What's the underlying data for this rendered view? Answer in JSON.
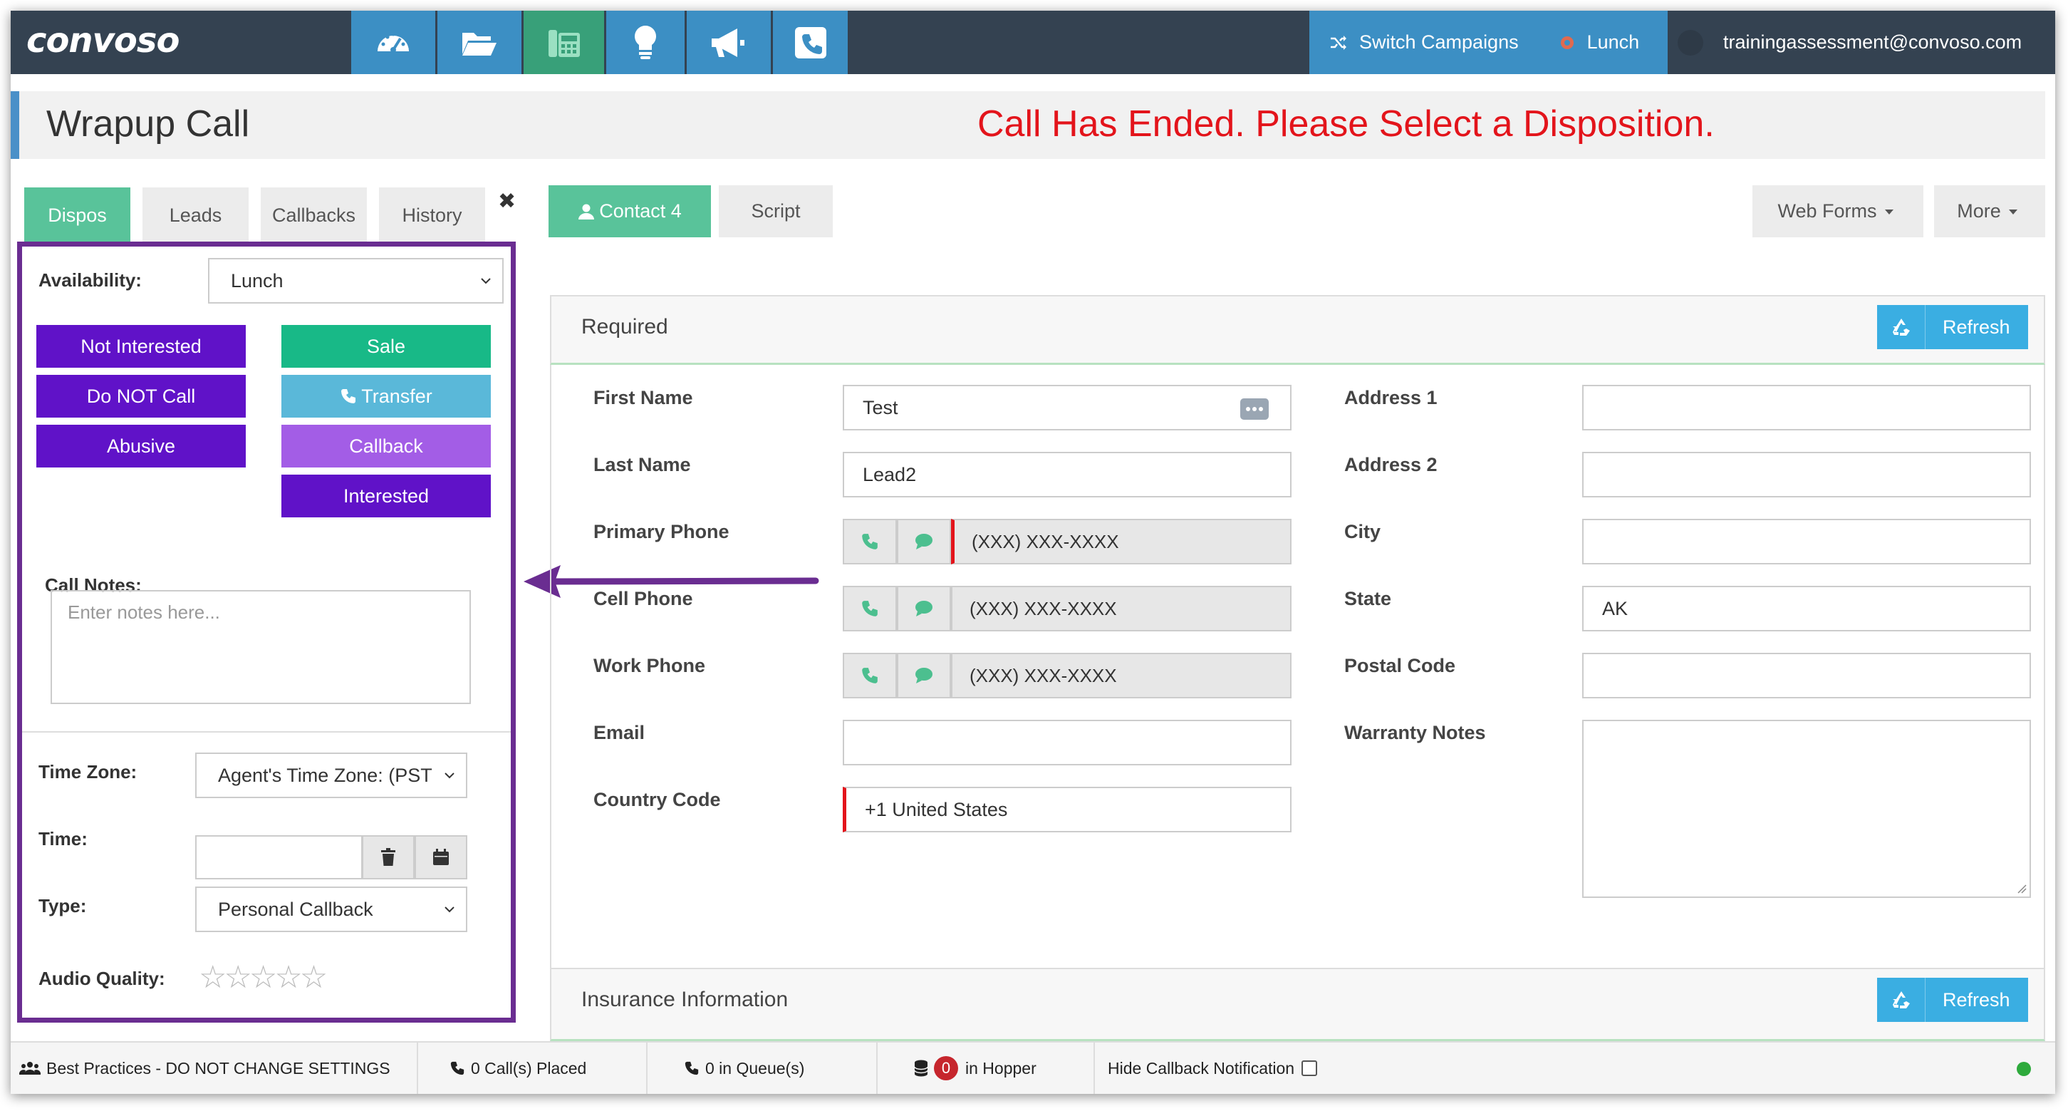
{
  "app": {
    "logo": "convoso"
  },
  "topbar": {
    "icons": [
      "dashboard-icon",
      "folder-icon",
      "phone-keypad-icon",
      "lightbulb-icon",
      "megaphone-icon",
      "phone-square-icon"
    ],
    "switch_campaigns": "Switch Campaigns",
    "status": "Lunch",
    "user_email": "trainingassessment@convoso.com"
  },
  "header": {
    "title": "Wrapup Call",
    "alert": "Call Has Ended. Please Select a Disposition."
  },
  "left_tabs": [
    "Dispos",
    "Leads",
    "Callbacks",
    "History"
  ],
  "left_panel": {
    "availability_label": "Availability:",
    "availability_value": "Lunch",
    "dispositions": {
      "not_interested": "Not Interested",
      "do_not_call": "Do NOT Call",
      "abusive": "Abusive",
      "sale": "Sale",
      "transfer": "Transfer",
      "callback": "Callback",
      "interested": "Interested"
    },
    "call_notes_label": "Call Notes:",
    "call_notes_placeholder": "Enter notes here...",
    "time_zone_label": "Time Zone:",
    "time_zone_value": "Agent's Time Zone: (PST",
    "time_label": "Time:",
    "type_label": "Type:",
    "type_value": "Personal Callback",
    "audio_quality_label": "Audio Quality:",
    "audio_quality_stars": "☆☆☆☆☆"
  },
  "right_tabs": {
    "contact": "Contact 4",
    "script": "Script",
    "web_forms": "Web Forms",
    "more": "More"
  },
  "required_section": {
    "title": "Required",
    "refresh": "Refresh",
    "first_name_label": "First Name",
    "first_name_value": "Test",
    "last_name_label": "Last Name",
    "last_name_value": "Lead2",
    "primary_phone_label": "Primary Phone",
    "primary_phone_value": "(XXX) XXX-XXXX",
    "cell_phone_label": "Cell Phone",
    "cell_phone_value": "(XXX) XXX-XXXX",
    "work_phone_label": "Work Phone",
    "work_phone_value": "(XXX) XXX-XXXX",
    "email_label": "Email",
    "email_value": "",
    "country_code_label": "Country Code",
    "country_code_value": "+1 United States",
    "address1_label": "Address 1",
    "address2_label": "Address 2",
    "city_label": "City",
    "state_label": "State",
    "state_value": "AK",
    "postal_code_label": "Postal Code",
    "warranty_notes_label": "Warranty Notes"
  },
  "insurance_section": {
    "title": "Insurance Information",
    "refresh": "Refresh"
  },
  "statusbar": {
    "campaign": "Best Practices - DO NOT CHANGE SETTINGS",
    "calls_placed": "0 Call(s) Placed",
    "in_queue": "0 in Queue(s)",
    "hopper_count": "0",
    "hopper_label": "in Hopper",
    "hide_callback": "Hide Callback Notification"
  },
  "colors": {
    "topbar": "#344251",
    "accent_blue": "#3c8fc4",
    "accent_green": "#59c39a",
    "alert_red": "#e3141b",
    "purple_dispo": "#6012c8",
    "panel_border": "#6a2d91"
  }
}
